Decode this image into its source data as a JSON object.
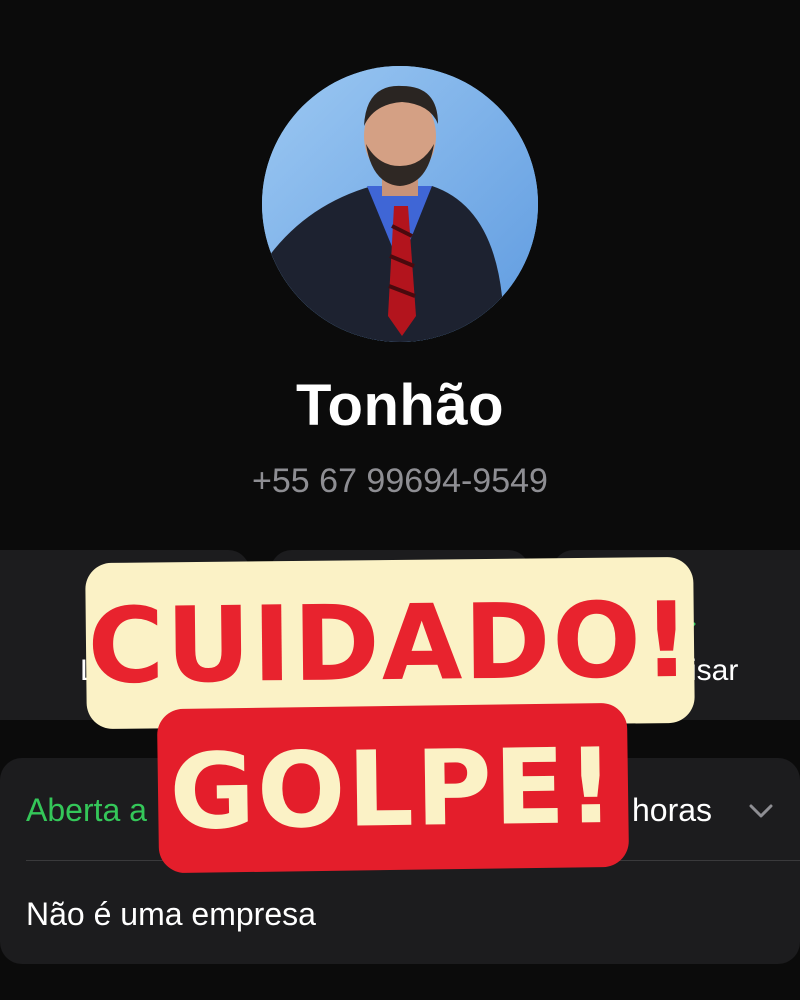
{
  "contact": {
    "name": "Tonhão",
    "phone": "+55 67 99694-9549"
  },
  "actions": {
    "left_label": "L",
    "right_label": "isar",
    "right_icon": "search-icon"
  },
  "info": {
    "hours_status": "Aberta a",
    "hours_detail": "horas",
    "business_note": "Não é uma empresa"
  },
  "overlay": {
    "warning_line_1": "CUIDADO!",
    "warning_line_2": "GOLPE!"
  },
  "colors": {
    "background": "#0b0b0b",
    "card": "#1c1c1e",
    "open_status": "#34c759",
    "warning_red": "#e41e2b",
    "warning_cream": "#fbf2c6"
  }
}
